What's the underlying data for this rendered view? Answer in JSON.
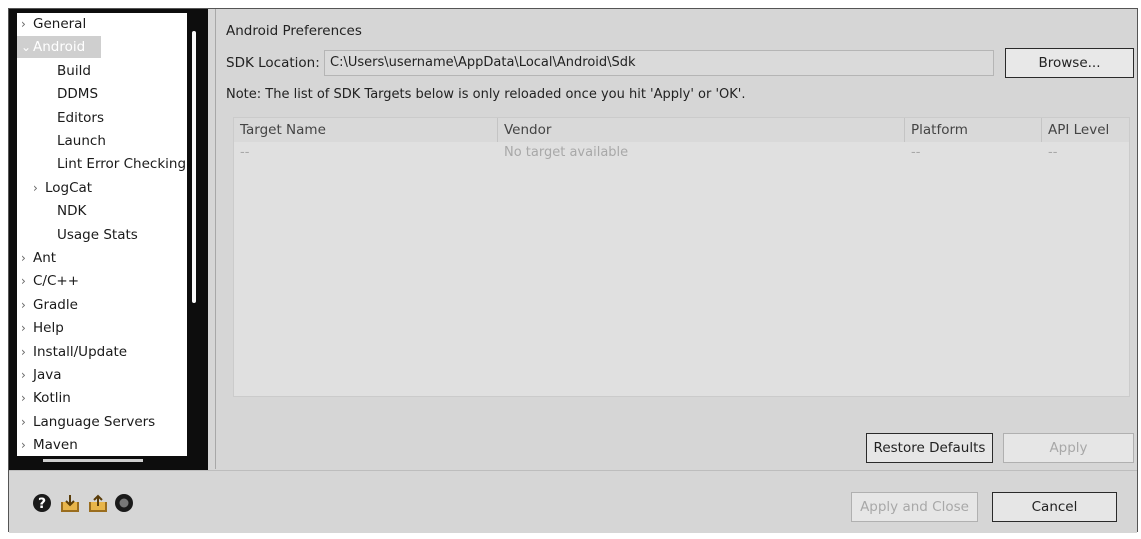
{
  "tree": {
    "items": [
      {
        "label": "General",
        "chevron": "chevron-right",
        "indent": 0
      },
      {
        "label": "Android",
        "chevron": "chevron-down",
        "indent": 0,
        "selected": true
      },
      {
        "label": "Build",
        "chevron": "",
        "indent": 2
      },
      {
        "label": "DDMS",
        "chevron": "",
        "indent": 2
      },
      {
        "label": "Editors",
        "chevron": "",
        "indent": 2
      },
      {
        "label": "Launch",
        "chevron": "",
        "indent": 2
      },
      {
        "label": "Lint Error Checking",
        "chevron": "",
        "indent": 2
      },
      {
        "label": "LogCat",
        "chevron": "chevron-right",
        "indent": 1
      },
      {
        "label": "NDK",
        "chevron": "",
        "indent": 2
      },
      {
        "label": "Usage Stats",
        "chevron": "",
        "indent": 2
      },
      {
        "label": "Ant",
        "chevron": "chevron-right",
        "indent": 0
      },
      {
        "label": "C/C++",
        "chevron": "chevron-right",
        "indent": 0
      },
      {
        "label": "Gradle",
        "chevron": "chevron-right",
        "indent": 0
      },
      {
        "label": "Help",
        "chevron": "chevron-right",
        "indent": 0
      },
      {
        "label": "Install/Update",
        "chevron": "chevron-right",
        "indent": 0
      },
      {
        "label": "Java",
        "chevron": "chevron-right",
        "indent": 0
      },
      {
        "label": "Kotlin",
        "chevron": "chevron-right",
        "indent": 0
      },
      {
        "label": "Language Servers",
        "chevron": "chevron-right",
        "indent": 0
      },
      {
        "label": "Maven",
        "chevron": "chevron-right",
        "indent": 0
      }
    ]
  },
  "prefs": {
    "title": "Android Preferences",
    "sdk_label": "SDK Location:",
    "sdk_value": "C:\\Users\\username\\AppData\\Local\\Android\\Sdk",
    "browse_label": "Browse...",
    "note": "Note: The list of SDK Targets below is only reloaded once you hit 'Apply' or 'OK'."
  },
  "table": {
    "columns": [
      "Target Name",
      "Vendor",
      "Platform",
      "API Level"
    ],
    "row": [
      "--",
      "No target available",
      "--",
      "--"
    ]
  },
  "buttons": {
    "restore_defaults": "Restore Defaults",
    "apply": "Apply",
    "apply_and_close": "Apply and Close",
    "cancel": "Cancel"
  },
  "icons": [
    "help-icon",
    "import-icon",
    "export-icon",
    "record-icon"
  ]
}
